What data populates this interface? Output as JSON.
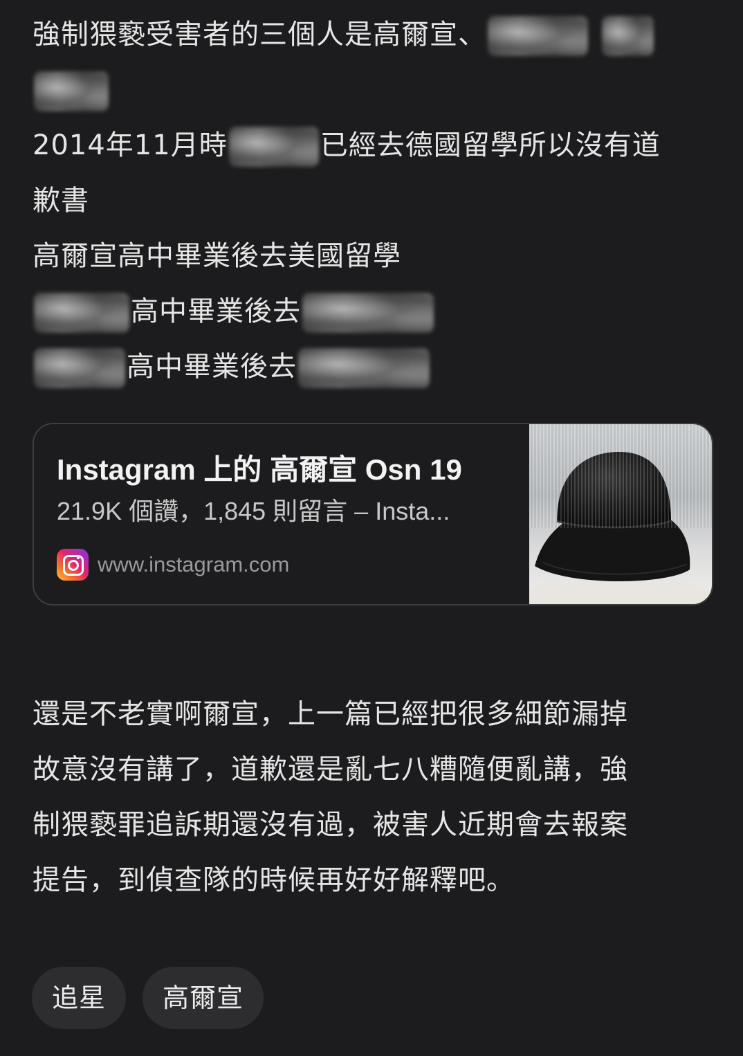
{
  "post": {
    "line1": "強制猥褻受害者的三個人是高爾宣、",
    "line3a": "2014年11月時",
    "line3b": "已經去德國留學所以沒有道",
    "line4": "歉書",
    "line5": "高爾宣高中畢業後去美國留學",
    "line6": "高中畢業後去",
    "line7": "高中畢業後去"
  },
  "link_card": {
    "title": "Instagram 上的 高爾宣 Osn 19",
    "subtitle": "21.9K 個讚，1,845 則留言 – Insta...",
    "source": "www.instagram.com",
    "source_icon": "instagram-icon",
    "image_subject": "black bucket hat"
  },
  "comment": {
    "lines": [
      "還是不老實啊爾宣，上一篇已經把很多細節漏掉",
      "故意沒有講了，道歉還是亂七八糟隨便亂講，強",
      "制猥褻罪追訴期還沒有過，被害人近期會去報案",
      "提告，到偵查隊的時候再好好解釋吧。"
    ]
  },
  "tags": [
    "追星",
    "高爾宣"
  ],
  "colors": {
    "background": "#1c1c1e",
    "text": "#e6e6e6",
    "card_border": "#3d3d40",
    "tag_background": "#2d2d30"
  }
}
